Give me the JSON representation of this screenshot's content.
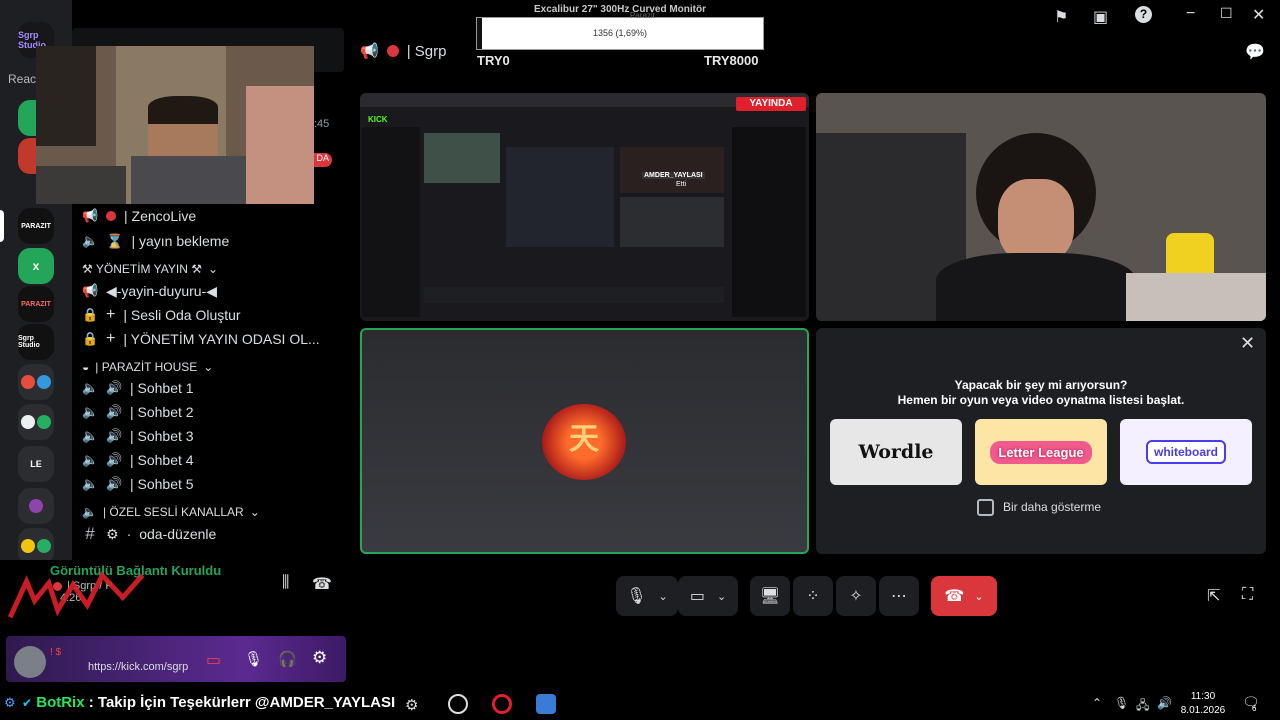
{
  "overlay": {
    "monitor_title": "Excalibur 27\" 300Hz Curved Monitör",
    "progress_text": "1356 (1,69%)",
    "progress_fraction": 0.0169,
    "min_label": "TRY0",
    "max_label": "TRY8000",
    "overlay_sublabel": "Parazit"
  },
  "voice_header": {
    "title": "| Sgrp"
  },
  "rail": {
    "servers": [
      "Sgrp Studio",
      "PARAZIT",
      "x",
      "PARAZIT",
      "Sgrp Studio",
      "LE"
    ]
  },
  "channels": {
    "top_time": ":45",
    "items": [
      {
        "icon": "megaphone-icon",
        "label": "| ZencoLive"
      },
      {
        "icon": "speaker-icon",
        "label": "| yayın bekleme"
      }
    ],
    "cat_management": "⚒ YÖNETİM YAYIN ⚒",
    "management_items": [
      {
        "label": "◀-yayin-duyuru-◀"
      },
      {
        "label": "| Sesli Oda Oluştur"
      },
      {
        "label": "| YÖNETİM YAYIN ODASI OL..."
      }
    ],
    "cat_house": "| PARAZİT HOUSE",
    "house_items": [
      "| Sohbet 1",
      "| Sohbet 2",
      "| Sohbet 3",
      "| Sohbet 4",
      "| Sohbet 5"
    ],
    "cat_private": "| ÖZEL SESLİ KANALLAR",
    "private_items": [
      "oda-düzenle"
    ]
  },
  "voice_status": {
    "title": "Görüntülü Bağlantı Kuruldu",
    "subtitle": "| Sgrp / P",
    "time": "4:26"
  },
  "user_panel": {
    "status": "! $",
    "url": "https://kick.com/sgrp"
  },
  "stage": {
    "live_badge": "YAYINDA",
    "kick_logo": "KICK",
    "overlay_tag": "AMDER_YAYLASI",
    "overlay_tag2": "Etti"
  },
  "activity": {
    "question": "Yapacak bir şey mi arıyorsun?",
    "prompt": "Hemen bir oyun veya video oynatma listesi başlat.",
    "games": [
      "Wordle",
      "Letter League",
      "whiteboard"
    ],
    "checkbox_label": "Bir daha gösterme"
  },
  "taskbar": {
    "bot_name": "BotRix",
    "ticker": ": Takip İçin Teşekürlerr @AMDER_YAYLASI",
    "time": "11:30",
    "date": "8.01.2026",
    "notif_count": "6"
  },
  "colors": {
    "accent_green": "#23a55a",
    "end_call_red": "#da373c",
    "kick_green": "#53fc18",
    "live_red": "#e0202a"
  }
}
